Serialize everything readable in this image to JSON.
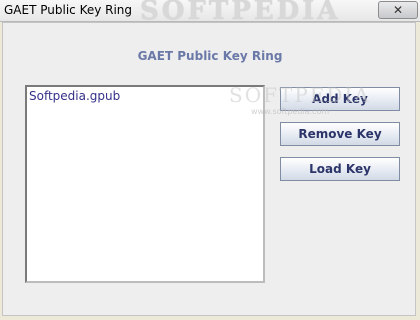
{
  "window": {
    "title": "GAET Public Key Ring",
    "watermark": "SOFTPEDIA",
    "close_glyph": "✕"
  },
  "main": {
    "heading": "GAET Public Key Ring",
    "keys": [
      "Softpedia.gpub"
    ],
    "watermark": "SOFTPEDIA",
    "watermark_url": "www.softpedia.com",
    "buttons": {
      "add": "Add Key",
      "remove": "Remove Key",
      "load": "Load Key"
    }
  },
  "icons": {
    "close": "close-icon"
  },
  "colors": {
    "heading": "#6b79a8",
    "list_text": "#34318a",
    "button_text": "#2c3569"
  }
}
